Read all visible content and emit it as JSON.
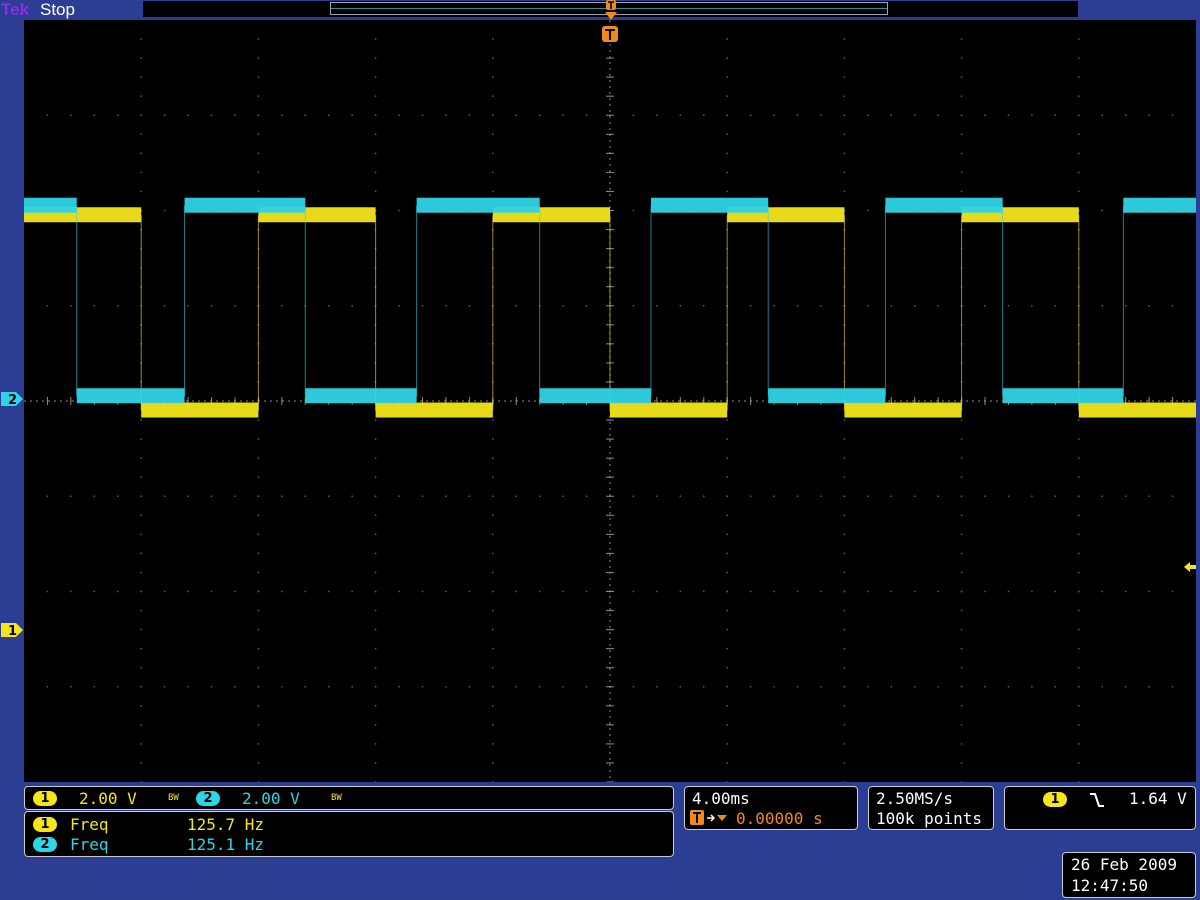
{
  "header": {
    "brand": "Tek",
    "status": "Stop"
  },
  "colors": {
    "ch1": "#f5e61a",
    "ch2": "#2fd4e6",
    "trigger": "#f08a18",
    "background": "#2c3e94",
    "screen": "#000000"
  },
  "icons": {
    "trigger_position": "trigger-T-icon",
    "trigger_level": "left-arrow-icon",
    "slope": "falling-edge-icon"
  },
  "channels": [
    {
      "number": "1",
      "scale": "2.00 V",
      "bw": "BW"
    },
    {
      "number": "2",
      "scale": "2.00 V",
      "bw": "BW"
    }
  ],
  "measurements": [
    {
      "channel": "1",
      "name": "Freq",
      "value": "125.7 Hz"
    },
    {
      "channel": "2",
      "name": "Freq",
      "value": "125.1 Hz"
    }
  ],
  "timebase": {
    "scale": "4.00ms",
    "trigger_delay": "0.00000 s"
  },
  "acquisition": {
    "sample_rate": "2.50MS/s",
    "record_length": "100k points"
  },
  "trigger": {
    "source": "1",
    "level": "1.64 V"
  },
  "datetime": {
    "date": "26 Feb  2009",
    "time": "12:47:50"
  },
  "chart_data": {
    "type": "line",
    "x_unit": "divisions",
    "y_unit": "divisions",
    "xlim": [
      -5,
      5
    ],
    "ylim": [
      -4,
      4
    ],
    "grid": true,
    "series": [
      {
        "name": "1",
        "transitions_div": [
          -4.0,
          -3.0,
          -2.0,
          -1.0,
          0.0,
          1.0,
          2.0,
          3.0,
          4.0
        ],
        "initial_state": "high",
        "high_div": 1.95,
        "low_div": -0.1
      },
      {
        "name": "2",
        "transitions_div": [
          -4.55,
          -3.63,
          -2.6,
          -1.65,
          -0.6,
          0.35,
          1.35,
          2.35,
          3.35,
          4.38
        ],
        "initial_state": "high",
        "high_div": 2.05,
        "low_div": 0.05
      }
    ]
  }
}
